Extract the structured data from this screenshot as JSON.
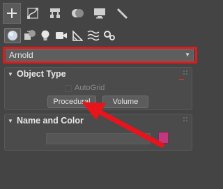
{
  "toolbar": {
    "tabs": [
      {
        "icon": "plus-icon",
        "active": true
      },
      {
        "icon": "modify-curve-icon"
      },
      {
        "icon": "hierarchy-icon"
      },
      {
        "icon": "motion-icon"
      },
      {
        "icon": "display-icon"
      },
      {
        "icon": "utilities-wrench-icon"
      }
    ]
  },
  "create_categories": [
    {
      "icon": "geometry-sphere-icon",
      "active": true
    },
    {
      "icon": "shapes-icon"
    },
    {
      "icon": "lights-icon"
    },
    {
      "icon": "cameras-icon"
    },
    {
      "icon": "helpers-icon"
    },
    {
      "icon": "space-warps-icon"
    },
    {
      "icon": "systems-icon"
    }
  ],
  "dropdown": {
    "selected": "Arnold"
  },
  "object_type": {
    "title": "Object Type",
    "autogrid_label": "AutoGrid",
    "buttons": [
      "Procedural",
      "Volume"
    ]
  },
  "name_and_color": {
    "title": "Name and Color",
    "name_value": "",
    "color_swatch": "#c0397d"
  },
  "annotation": {
    "highlight_color": "#e01b1b",
    "arrow_color": "#e8141c"
  }
}
